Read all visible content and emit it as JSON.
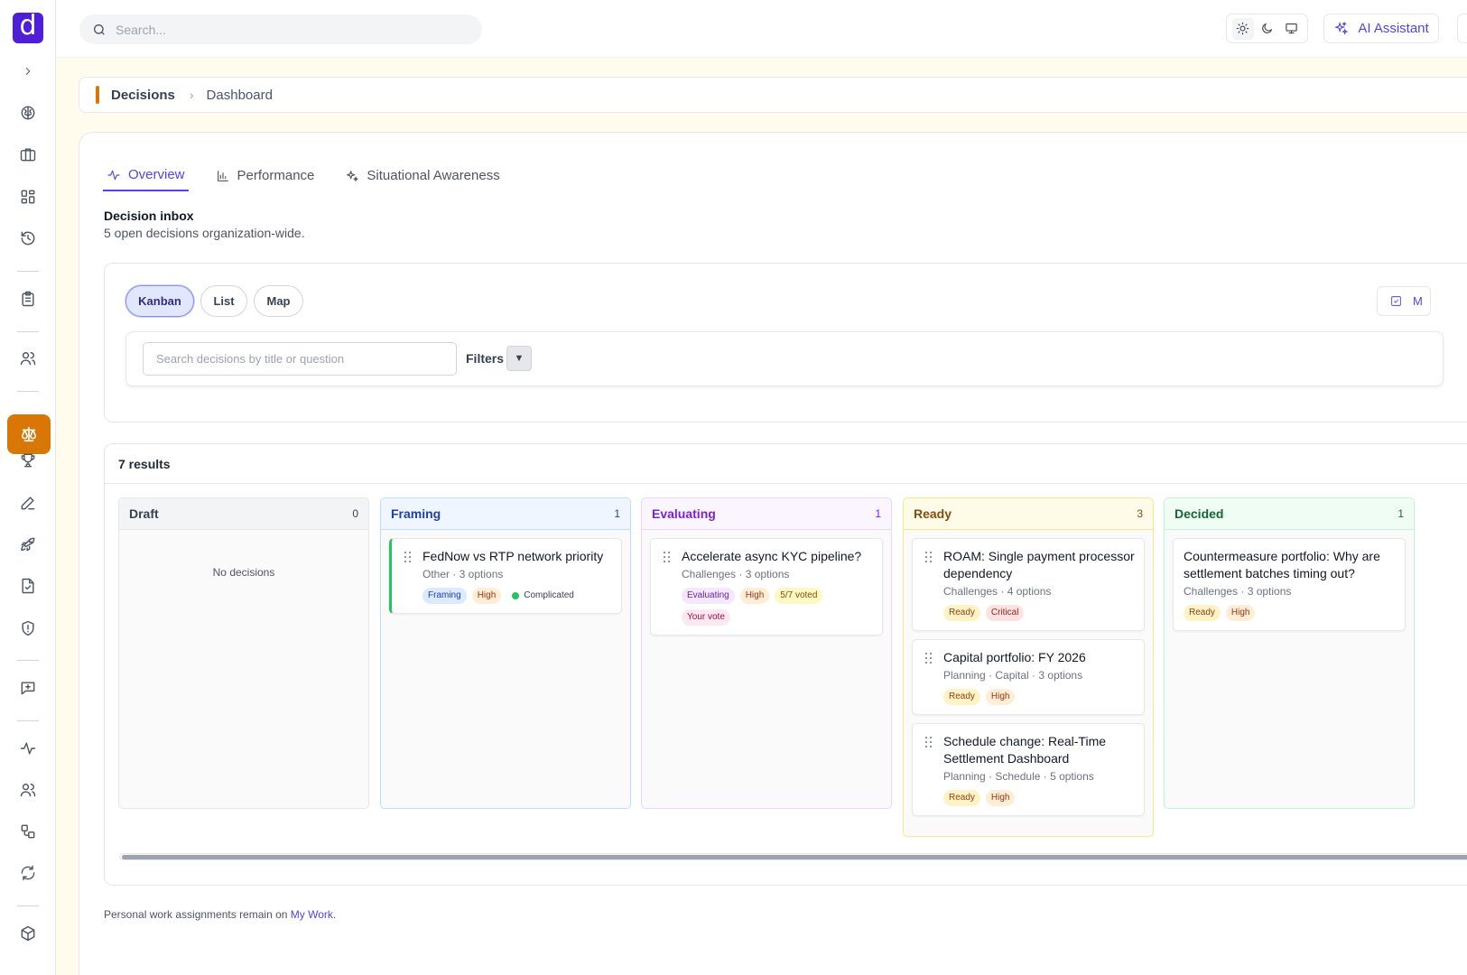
{
  "app": {
    "logo_letter": "d",
    "brand_color": "#4f1fd6",
    "accent_color": "#d97706"
  },
  "sidebar": {
    "items": [
      {
        "name": "chevron-right-icon"
      },
      {
        "name": "brain-icon"
      },
      {
        "name": "briefcase-icon"
      },
      {
        "name": "dashboard-grid-icon"
      },
      {
        "name": "history-icon"
      },
      {
        "name": "clipboard-icon"
      },
      {
        "name": "users-icon"
      },
      {
        "name": "scale-icon",
        "active": true
      },
      {
        "name": "trophy-icon"
      },
      {
        "name": "pen-icon"
      },
      {
        "name": "rocket-icon"
      },
      {
        "name": "file-check-icon"
      },
      {
        "name": "shield-alert-icon"
      },
      {
        "name": "message-plus-icon"
      },
      {
        "name": "activity-icon"
      },
      {
        "name": "users-icon"
      },
      {
        "name": "workflow-icon"
      },
      {
        "name": "refresh-icon"
      },
      {
        "name": "package-icon"
      }
    ]
  },
  "topbar": {
    "search_placeholder": "Search...",
    "theme_options": [
      "sun-icon",
      "moon-icon",
      "monitor-icon"
    ],
    "ai_assistant_label": "AI Assistant"
  },
  "breadcrumb": {
    "first": "Decisions",
    "second": "Dashboard"
  },
  "tabs": [
    {
      "label": "Overview",
      "icon": "activity-icon",
      "active": true
    },
    {
      "label": "Performance",
      "icon": "bar-chart-icon",
      "active": false
    },
    {
      "label": "Situational Awareness",
      "icon": "sparkles-icon",
      "active": false
    }
  ],
  "inbox": {
    "title": "Decision inbox",
    "subtitle": "5 open decisions organization-wide."
  },
  "views": {
    "kanban": "Kanban",
    "list": "List",
    "map": "Map",
    "active": "Kanban",
    "right_button_label": "M"
  },
  "filters": {
    "search_placeholder": "Search decisions by title or question",
    "label": "Filters",
    "toggle": "▼"
  },
  "results": {
    "count_label": "7 results"
  },
  "columns": [
    {
      "title": "Draft",
      "count": "0",
      "head_bg": "#f3f4f6",
      "head_color": "#374151",
      "border": "#e5e7eb",
      "empty_text": "No decisions",
      "cards": []
    },
    {
      "title": "Framing",
      "count": "1",
      "head_bg": "#eff6ff",
      "head_color": "#1e40af",
      "border": "#bfdbfe",
      "cards": [
        {
          "title": "FedNow vs RTP network priority",
          "meta": "Other · 3 options",
          "tags": [
            {
              "text": "Framing",
              "cls": "t-framing"
            },
            {
              "text": "High",
              "cls": "t-high"
            },
            {
              "text": "Complicated",
              "cls": "t-complicated",
              "dot": true
            }
          ]
        }
      ]
    },
    {
      "title": "Evaluating",
      "count": "1",
      "head_bg": "#faf5ff",
      "head_color": "#7e22ce",
      "border": "#e9d5ff",
      "cards": [
        {
          "title": "Accelerate async KYC pipeline?",
          "meta": "Challenges · 3 options",
          "tags": [
            {
              "text": "Evaluating",
              "cls": "t-eval"
            },
            {
              "text": "High",
              "cls": "t-high"
            },
            {
              "text": "5/7 voted",
              "cls": "t-voted"
            },
            {
              "text": "Your vote",
              "cls": "t-yourvote"
            }
          ]
        }
      ]
    },
    {
      "title": "Ready",
      "count": "3",
      "head_bg": "#fefce8",
      "head_color": "#854d0e",
      "border": "#fde68a",
      "cards": [
        {
          "title": "ROAM: Single payment processor dependency",
          "meta": "Challenges · 4 options",
          "tags": [
            {
              "text": "Ready",
              "cls": "t-ready"
            },
            {
              "text": "Critical",
              "cls": "t-critical"
            }
          ]
        },
        {
          "title": "Capital portfolio: FY 2026",
          "meta": "Planning · Capital · 3 options",
          "tags": [
            {
              "text": "Ready",
              "cls": "t-ready"
            },
            {
              "text": "High",
              "cls": "t-high"
            }
          ]
        },
        {
          "title": "Schedule change: Real-Time Settlement Dashboard",
          "meta": "Planning · Schedule · 5 options",
          "tags": [
            {
              "text": "Ready",
              "cls": "t-ready"
            },
            {
              "text": "High",
              "cls": "t-high"
            }
          ]
        }
      ]
    },
    {
      "title": "Decided",
      "count": "1",
      "head_bg": "#f0fdf4",
      "head_color": "#166534",
      "border": "#bbf7d0",
      "cards": [
        {
          "title": "Countermeasure portfolio: Why are settlement batches timing out?",
          "meta": "Challenges · 3 options",
          "no_handle": true,
          "tags": [
            {
              "text": "Ready",
              "cls": "t-ready"
            },
            {
              "text": "High",
              "cls": "t-high"
            }
          ]
        }
      ]
    }
  ],
  "footer": {
    "text": "Personal work assignments remain on ",
    "link": "My Work",
    "suffix": "."
  }
}
